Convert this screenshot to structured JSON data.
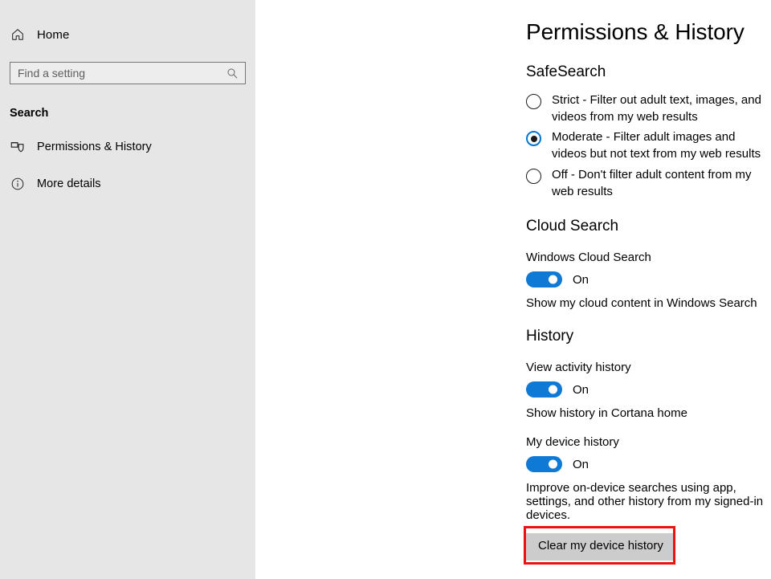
{
  "sidebar": {
    "home": {
      "label": "Home",
      "icon": "home-icon"
    },
    "search_field": {
      "value": "",
      "placeholder": "Find a setting",
      "icon": "search-icon"
    },
    "section_header": "Search",
    "items": [
      {
        "label": "Permissions & History",
        "icon": "shield-permissions-icon",
        "selected": true
      },
      {
        "label": "More details",
        "icon": "info-circle-icon",
        "selected": false
      }
    ]
  },
  "main": {
    "title": "Permissions & History",
    "safesearch": {
      "heading": "SafeSearch",
      "options": [
        {
          "label": "Strict - Filter out adult text, images, and videos from my web results",
          "checked": false
        },
        {
          "label": "Moderate - Filter adult images and videos but not text from my web results",
          "checked": true
        },
        {
          "label": "Off - Don't filter adult content from my web results",
          "checked": false
        }
      ]
    },
    "cloud_search": {
      "heading": "Cloud Search",
      "setting_label": "Windows Cloud Search",
      "toggle_state": "On",
      "description": "Show my cloud content in Windows Search"
    },
    "history": {
      "heading": "History",
      "activity": {
        "setting_label": "View activity history",
        "toggle_state": "On",
        "description": "Show history in Cortana home"
      },
      "device": {
        "setting_label": "My device history",
        "toggle_state": "On",
        "description": "Improve on-device searches using app, settings, and other history from my signed-in devices.",
        "button_label": "Clear my device history"
      }
    }
  },
  "colors": {
    "accent_blue": "#0f7ad6",
    "radio_accent": "#0078d4",
    "sidebar_bg": "#e6e6e6",
    "button_bg": "#cccccc",
    "highlight_red": "#ee1111"
  }
}
